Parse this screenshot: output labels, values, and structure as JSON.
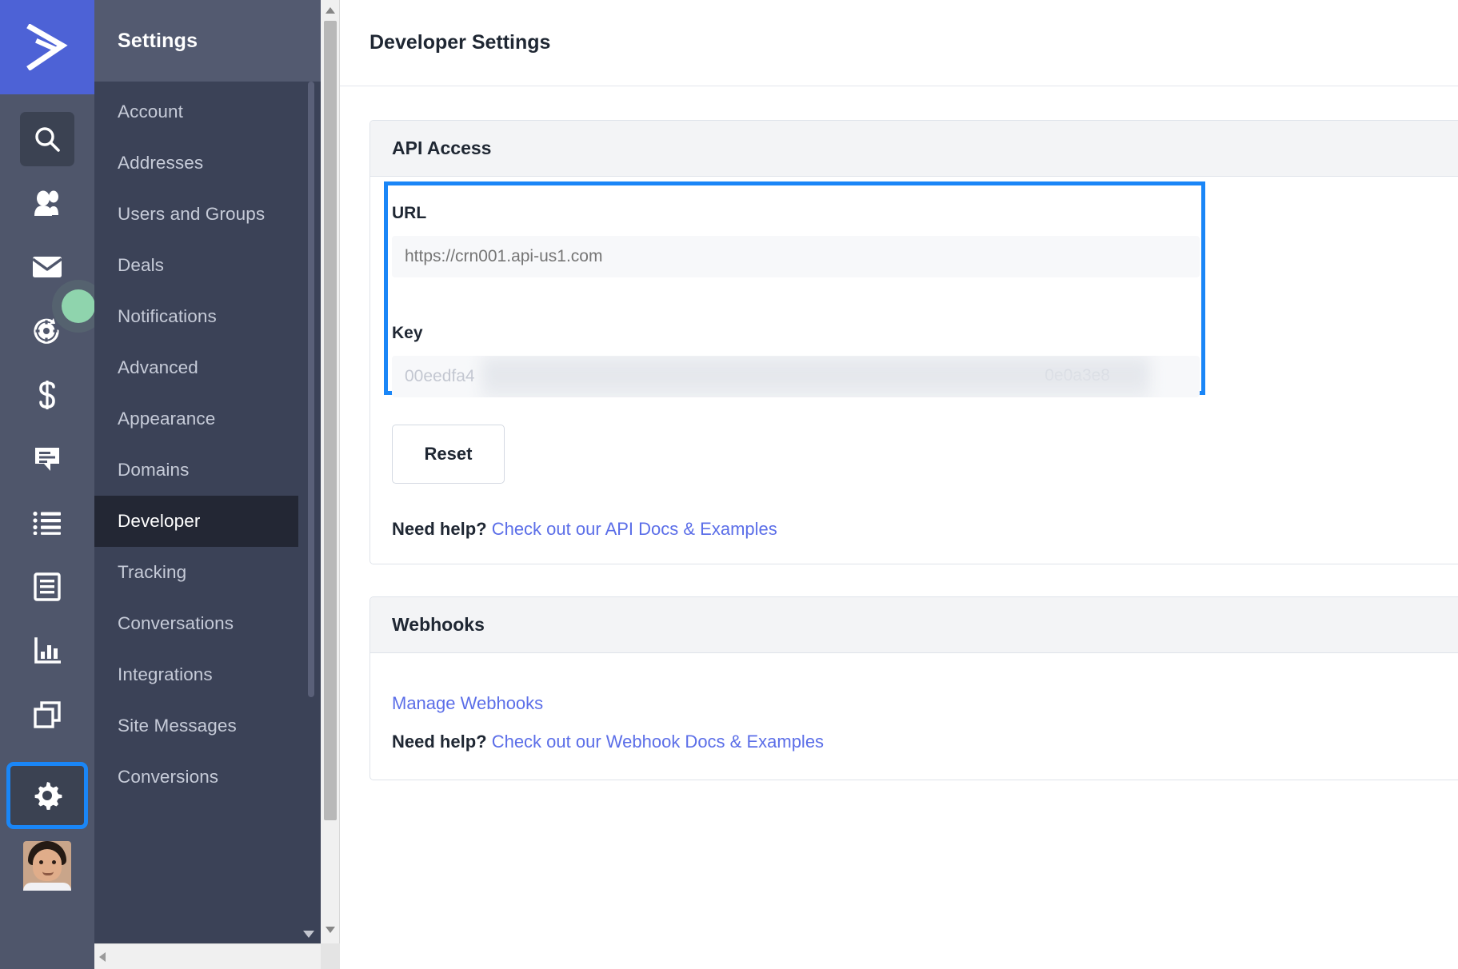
{
  "brand": {
    "logo_icon": "chevron-right-logo-icon",
    "accent_blue": "#4d62d6",
    "focus_blue": "#1a86f7"
  },
  "icon_rail": {
    "items": [
      {
        "icon": "search-icon",
        "name": "search"
      },
      {
        "icon": "contacts-icon",
        "name": "contacts"
      },
      {
        "icon": "mail-icon",
        "name": "campaigns"
      },
      {
        "icon": "automations-icon",
        "name": "automations",
        "status_dot": "#8fd4ad"
      },
      {
        "icon": "dollar-icon",
        "name": "deals"
      },
      {
        "icon": "conversations-icon",
        "name": "conversations"
      },
      {
        "icon": "list-icon",
        "name": "lists"
      },
      {
        "icon": "forms-icon",
        "name": "forms"
      },
      {
        "icon": "reports-icon",
        "name": "reports"
      },
      {
        "icon": "pages-icon",
        "name": "pages"
      },
      {
        "icon": "gear-icon",
        "name": "settings"
      },
      {
        "icon": "avatar",
        "name": "user-profile"
      }
    ]
  },
  "settings_panel": {
    "title": "Settings",
    "items": [
      {
        "label": "Account",
        "active": false
      },
      {
        "label": "Addresses",
        "active": false
      },
      {
        "label": "Users and Groups",
        "active": false
      },
      {
        "label": "Deals",
        "active": false
      },
      {
        "label": "Notifications",
        "active": false
      },
      {
        "label": "Advanced",
        "active": false
      },
      {
        "label": "Appearance",
        "active": false
      },
      {
        "label": "Domains",
        "active": false
      },
      {
        "label": "Developer",
        "active": true
      },
      {
        "label": "Tracking",
        "active": false
      },
      {
        "label": "Conversations",
        "active": false
      },
      {
        "label": "Integrations",
        "active": false
      },
      {
        "label": "Site Messages",
        "active": false
      },
      {
        "label": "Conversions",
        "active": false
      }
    ]
  },
  "main": {
    "page_title": "Developer Settings",
    "api_card": {
      "title": "API Access",
      "url_label": "URL",
      "url_placeholder": "https://crn001.api-us1.com",
      "url_value": "",
      "key_label": "Key",
      "key_value_start": "00eedfa4",
      "key_value_end": "0e0a3e8",
      "reset_label": "Reset",
      "help_prefix": "Need help?",
      "help_link": "Check out our API Docs & Examples"
    },
    "webhooks_card": {
      "title": "Webhooks",
      "manage_link": "Manage Webhooks",
      "help_prefix": "Need help?",
      "help_link": "Check out our Webhook Docs & Examples"
    }
  }
}
